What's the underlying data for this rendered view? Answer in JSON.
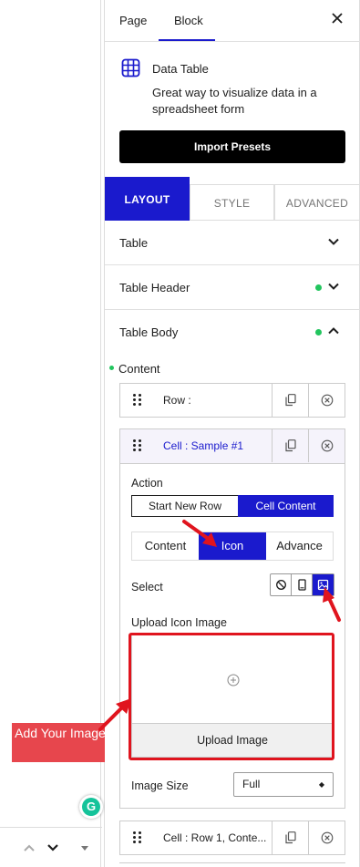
{
  "panel_tabs": {
    "page": "Page",
    "block": "Block"
  },
  "block": {
    "title": "Data Table",
    "description": "Great way to visualize data in a spreadsheet form",
    "import_label": "Import Presets"
  },
  "modes": {
    "layout": "LAYOUT",
    "style": "STYLE",
    "advanced": "ADVANCED"
  },
  "sections": {
    "table": "Table",
    "table_header": "Table Header",
    "table_body": "Table Body"
  },
  "content_label": "Content",
  "rows": {
    "row": "Row :",
    "cell_sample": "Cell : Sample #1",
    "cell_row1": "Cell : Row 1, Conte..."
  },
  "cell_settings": {
    "action_label": "Action",
    "action_options": [
      "Start New Row",
      "Cell Content"
    ],
    "action_selected": "Cell Content",
    "content_tabs": [
      "Content",
      "Icon",
      "Advance"
    ],
    "content_tab_selected": "Icon",
    "select_label": "Select",
    "select_icons": [
      "none-icon",
      "device-icon",
      "image-icon"
    ],
    "select_selected": "image-icon",
    "upload_label": "Upload Icon Image",
    "upload_button": "Upload Image",
    "size_label": "Image Size",
    "size_value": "Full"
  },
  "callout": {
    "text": "Add Your Image"
  },
  "colors": {
    "accent": "#1a1acd",
    "annotation_red": "#e0141e",
    "status_green": "#22c55e",
    "callout_bg": "#e7464d"
  }
}
